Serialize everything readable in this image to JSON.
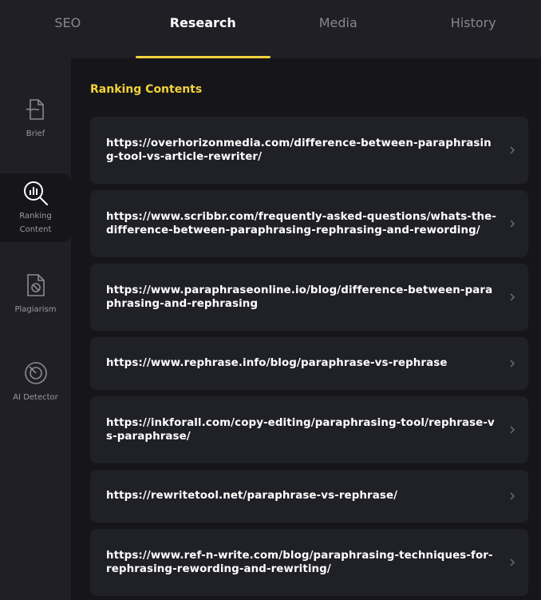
{
  "tabs": [
    {
      "label": "SEO",
      "active": false
    },
    {
      "label": "Research",
      "active": true
    },
    {
      "label": "Media",
      "active": false
    },
    {
      "label": "History",
      "active": false
    }
  ],
  "sidebar": {
    "items": [
      {
        "label": "Brief",
        "icon": "brief-icon"
      },
      {
        "label": "Ranking\nContent",
        "icon": "ranking-content-icon",
        "active": true
      },
      {
        "label": "Plagiarism",
        "icon": "plagiarism-icon"
      },
      {
        "label": "AI Detector",
        "icon": "ai-detector-icon"
      }
    ]
  },
  "main": {
    "section_title": "Ranking Contents",
    "links": [
      "https://overhorizonmedia.com/difference-between-paraphrasing-tool-vs-article-rewriter/",
      "https://www.scribbr.com/frequently-asked-questions/whats-the-difference-between-paraphrasing-rephrasing-and-rewording/",
      "https://www.paraphraseonline.io/blog/difference-between-paraphrasing-and-rephrasing",
      "https://www.rephrase.info/blog/paraphrase-vs-rephrase",
      "https://inkforall.com/copy-editing/paraphrasing-tool/rephrase-vs-paraphrase/",
      "https://rewritetool.net/paraphrase-vs-rephrase/",
      "https://www.ref-n-write.com/blog/paraphrasing-techniques-for-rephrasing-rewording-and-rewriting/"
    ]
  },
  "colors": {
    "accent": "#f2d23c",
    "background": "#16161a",
    "panel": "#1f1f25",
    "card": "#202027"
  }
}
